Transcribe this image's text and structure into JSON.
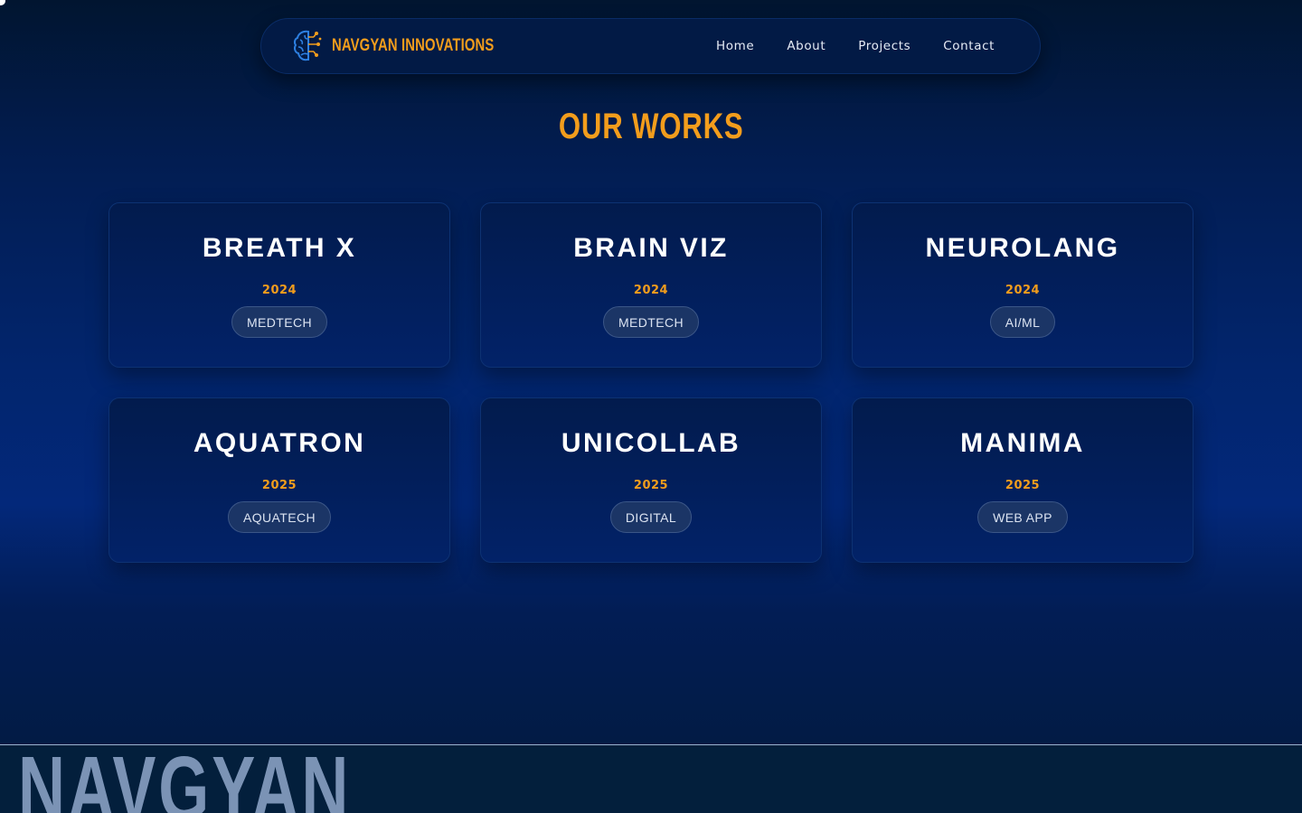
{
  "brand": {
    "name": "NAVGYAN INNOVATIONS",
    "icon": "brain-circuit-icon"
  },
  "nav": {
    "links": [
      "Home",
      "About",
      "Projects",
      "Contact"
    ]
  },
  "page": {
    "title": "OUR WORKS"
  },
  "projects": [
    {
      "title": "BREATH X",
      "year": "2024",
      "tag": "MEDTECH"
    },
    {
      "title": "BRAIN VIZ",
      "year": "2024",
      "tag": "MEDTECH"
    },
    {
      "title": "NEUROLANG",
      "year": "2024",
      "tag": "AI/ML"
    },
    {
      "title": "AQUATRON",
      "year": "2025",
      "tag": "AQUATECH"
    },
    {
      "title": "UNICOLLAB",
      "year": "2025",
      "tag": "DIGITAL"
    },
    {
      "title": "MANIMA",
      "year": "2025",
      "tag": "WEB APP"
    }
  ],
  "footer": {
    "big_text": "NAVGYAN"
  },
  "colors": {
    "accent": "#f39d1c",
    "background": "#021d52",
    "card": "#022268",
    "tag": "#1b3566"
  }
}
